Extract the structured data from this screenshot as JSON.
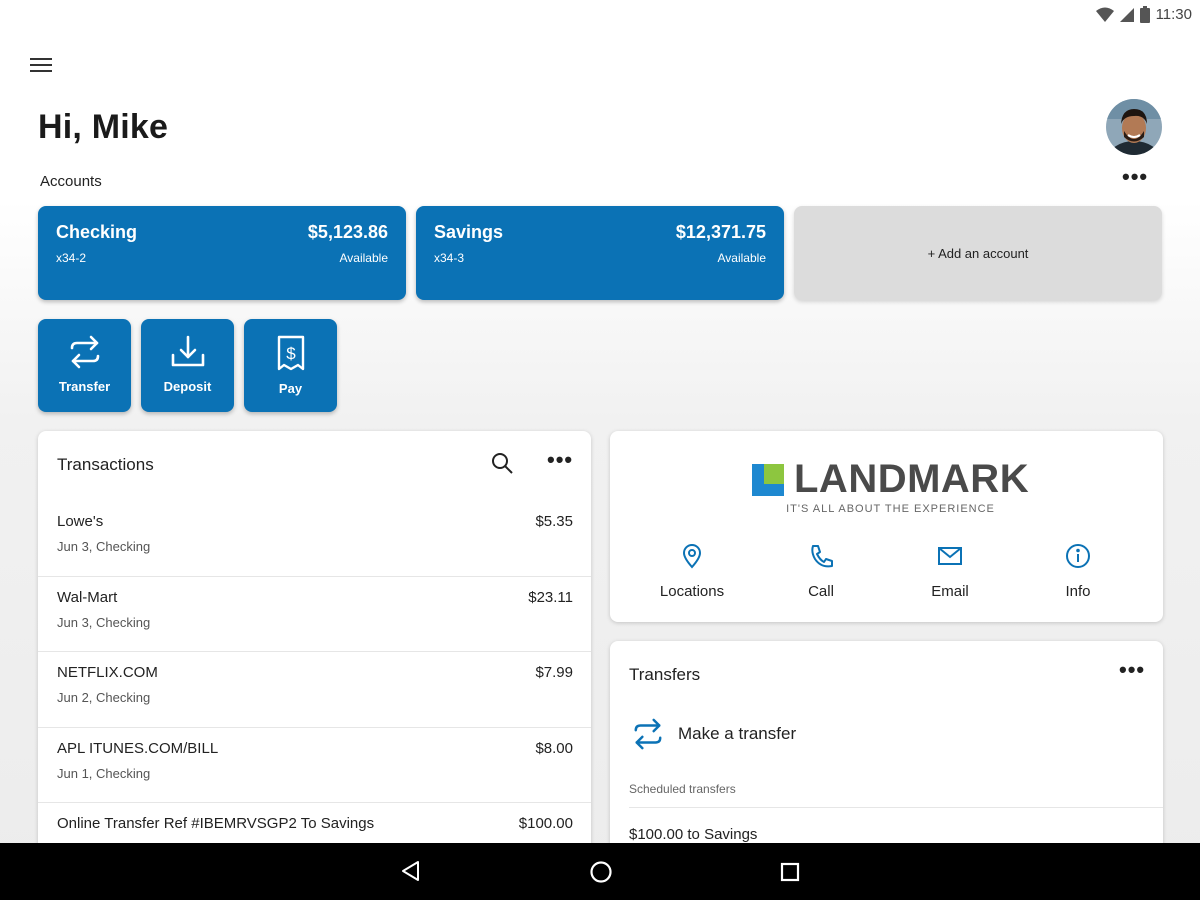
{
  "status": {
    "time": "11:30",
    "icons": [
      "wifi-icon",
      "signal-icon",
      "battery-icon"
    ]
  },
  "header": {
    "greeting": "Hi, Mike",
    "menu_icon": "hamburger-menu-icon",
    "avatar_icon": "user-avatar"
  },
  "accounts": {
    "label": "Accounts",
    "more": "•••",
    "items": [
      {
        "name": "Checking",
        "number": "x34-2",
        "balance": "$5,123.86",
        "balance_label": "Available"
      },
      {
        "name": "Savings",
        "number": "x34-3",
        "balance": "$12,371.75",
        "balance_label": "Available"
      }
    ],
    "add_label": "+ Add an account"
  },
  "actions": [
    {
      "label": "Transfer",
      "icon": "transfer-icon"
    },
    {
      "label": "Deposit",
      "icon": "deposit-icon"
    },
    {
      "label": "Pay",
      "icon": "pay-bill-icon"
    }
  ],
  "transactions": {
    "title": "Transactions",
    "more": "•••",
    "items": [
      {
        "name": "Lowe's",
        "sub": "Jun 3, Checking",
        "amount": "$5.35"
      },
      {
        "name": "Wal-Mart",
        "sub": "Jun 3, Checking",
        "amount": "$23.11"
      },
      {
        "name": "NETFLIX.COM",
        "sub": "Jun 2, Checking",
        "amount": "$7.99"
      },
      {
        "name": "APL ITUNES.COM/BILL",
        "sub": "Jun 1, Checking",
        "amount": "$8.00"
      },
      {
        "name": "Online Transfer Ref #IBEMRVSGP2 To Savings",
        "sub": "",
        "amount": "$100.00"
      }
    ]
  },
  "bank": {
    "name": "LANDMARK",
    "tagline": "IT'S ALL ABOUT THE EXPERIENCE",
    "contacts": [
      {
        "label": "Locations",
        "icon": "location-pin-icon"
      },
      {
        "label": "Call",
        "icon": "phone-icon"
      },
      {
        "label": "Email",
        "icon": "email-icon"
      },
      {
        "label": "Info",
        "icon": "info-icon"
      }
    ],
    "colors": {
      "brand_blue": "#0b72b5",
      "logo_green": "#8dc63f",
      "logo_blue": "#1e88d0"
    }
  },
  "transfers": {
    "title": "Transfers",
    "more": "•••",
    "make_label": "Make a transfer",
    "scheduled_label": "Scheduled transfers",
    "scheduled": [
      "$100.00 to Savings"
    ]
  },
  "navigation": {
    "icons": [
      "back-icon",
      "home-icon",
      "recents-icon"
    ]
  }
}
